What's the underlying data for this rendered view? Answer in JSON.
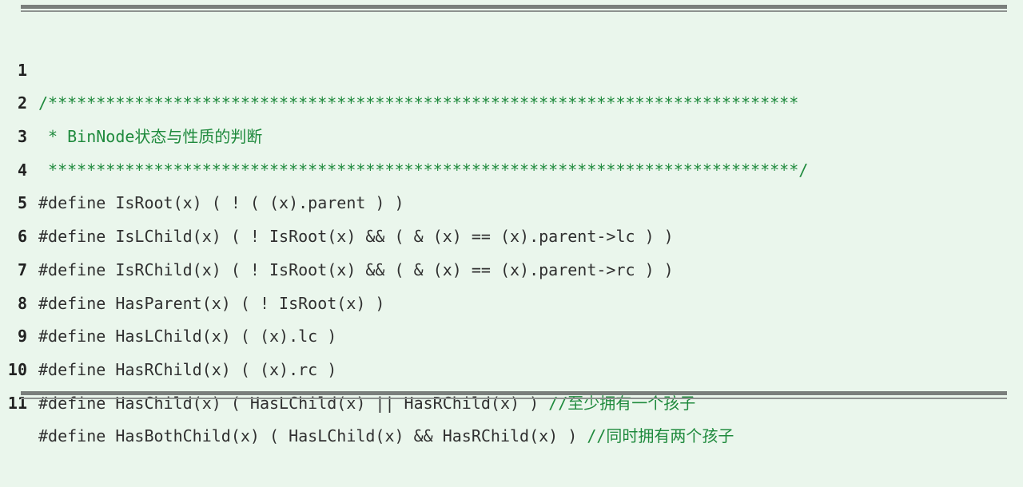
{
  "lines": [
    {
      "num": "1",
      "code": "",
      "comment": "/******************************************************************************"
    },
    {
      "num": "2",
      "code": "",
      "comment": " * BinNode状态与性质的判断"
    },
    {
      "num": "3",
      "code": "",
      "comment": " ******************************************************************************/"
    },
    {
      "num": "4",
      "code": "#define IsRoot(x) ( ! ( (x).parent ) )",
      "comment": ""
    },
    {
      "num": "5",
      "code": "#define IsLChild(x) ( ! IsRoot(x) && ( & (x) == (x).parent->lc ) )",
      "comment": ""
    },
    {
      "num": "6",
      "code": "#define IsRChild(x) ( ! IsRoot(x) && ( & (x) == (x).parent->rc ) )",
      "comment": ""
    },
    {
      "num": "7",
      "code": "#define HasParent(x) ( ! IsRoot(x) )",
      "comment": ""
    },
    {
      "num": "8",
      "code": "#define HasLChild(x) ( (x).lc )",
      "comment": ""
    },
    {
      "num": "9",
      "code": "#define HasRChild(x) ( (x).rc )",
      "comment": ""
    },
    {
      "num": "10",
      "code": "#define HasChild(x) ( HasLChild(x) || HasRChild(x) ) ",
      "comment": "//至少拥有一个孩子"
    },
    {
      "num": "11",
      "code": "#define HasBothChild(x) ( HasLChild(x) && HasRChild(x) ) ",
      "comment": "//同时拥有两个孩子"
    }
  ],
  "colors": {
    "comment": "#1f8a3d",
    "code": "#2b2b2b",
    "background": "#eaf6ec"
  }
}
